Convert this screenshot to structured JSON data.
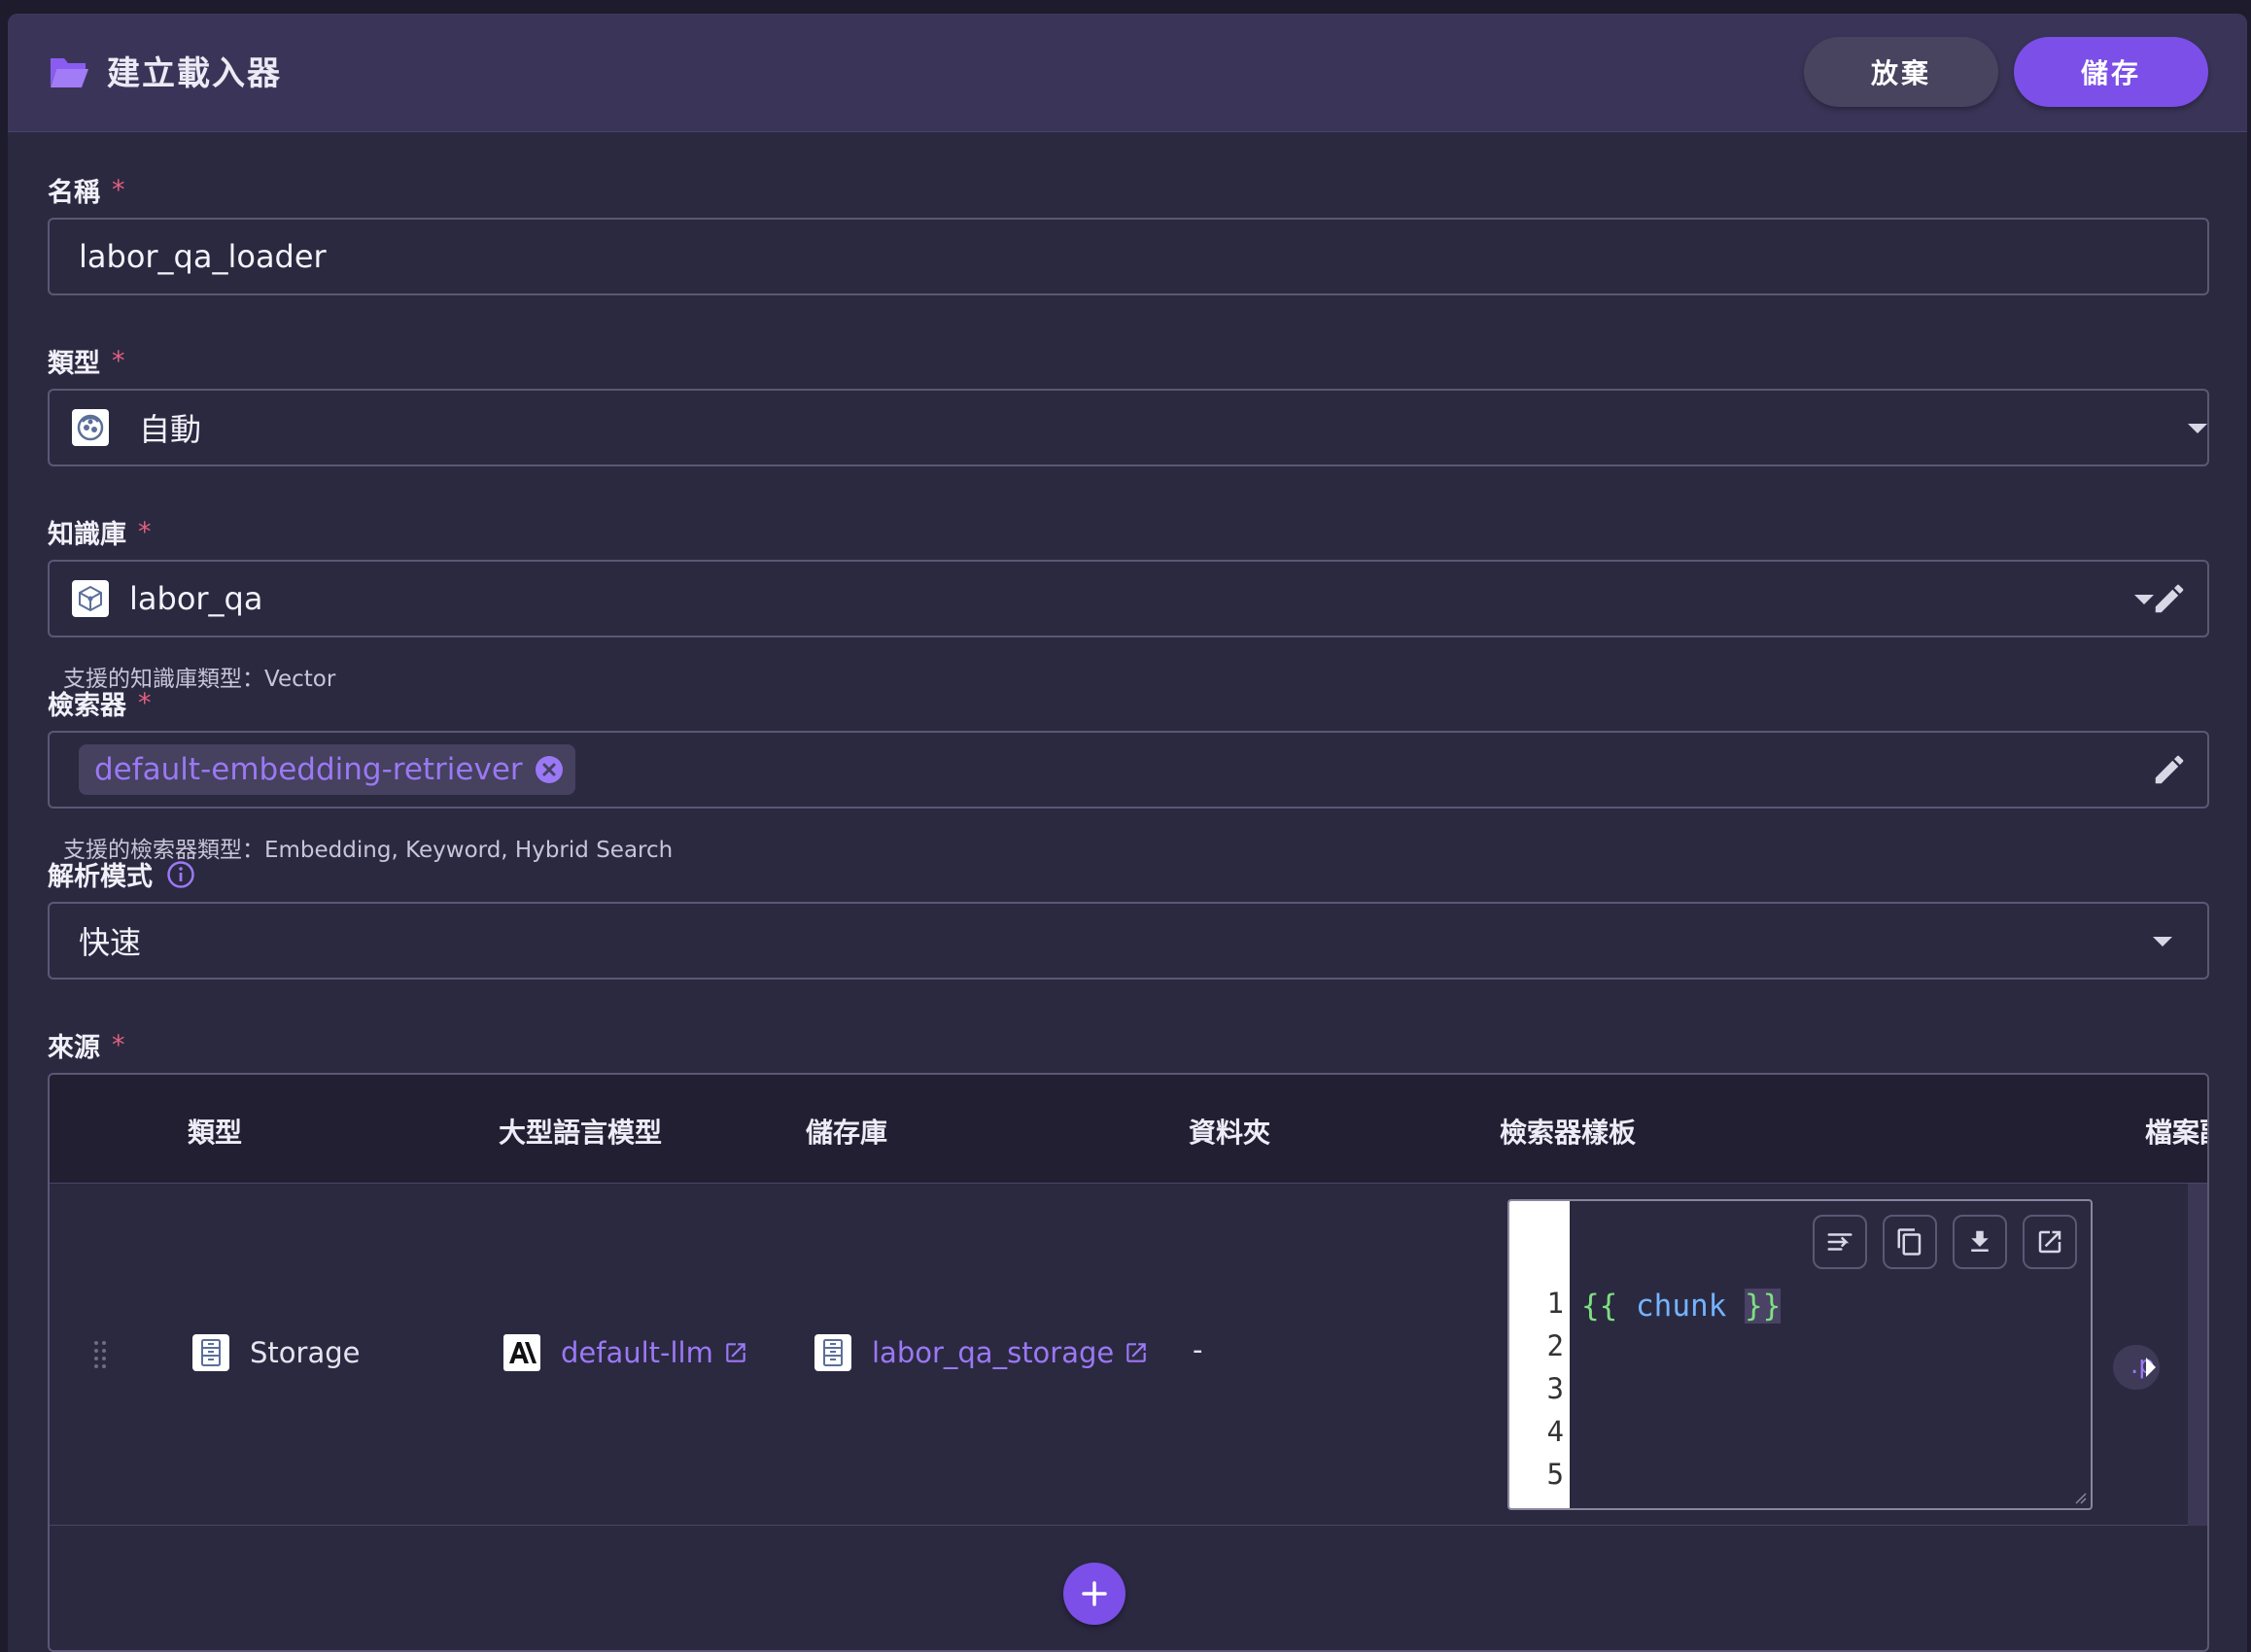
{
  "header": {
    "title": "建立載入器",
    "discard_label": "放棄",
    "save_label": "儲存"
  },
  "fields": {
    "name": {
      "label": "名稱",
      "required": "*",
      "value": "labor_qa_loader"
    },
    "type": {
      "label": "類型",
      "required": "*",
      "value": "自動"
    },
    "knowledge_base": {
      "label": "知識庫",
      "required": "*",
      "value": "labor_qa",
      "hint": "支援的知識庫類型：Vector"
    },
    "retriever": {
      "label": "檢索器",
      "required": "*",
      "chip": "default-embedding-retriever",
      "hint": "支援的檢索器類型：Embedding, Keyword, Hybrid Search"
    },
    "parse_mode": {
      "label": "解析模式",
      "value": "快速"
    },
    "source": {
      "label": "來源",
      "required": "*"
    }
  },
  "table": {
    "columns": [
      "類型",
      "大型語言模型",
      "儲存庫",
      "資料夾",
      "檢索器樣板",
      "檔案副"
    ],
    "rows": [
      {
        "type": "Storage",
        "llm": "default-llm",
        "storage": "labor_qa_storage",
        "folder": "-",
        "template": {
          "line_numbers": [
            "1",
            "2",
            "3",
            "4",
            "5"
          ],
          "open": "{{",
          "keyword": " chunk ",
          "close": "}}"
        },
        "extension_partial": ".p"
      }
    ]
  },
  "colors": {
    "accent": "#7b4fe8",
    "link": "#9b78f5",
    "required": "#e0607e",
    "header_bg": "#3a3558",
    "panel_bg": "#2b2940"
  },
  "icons": {
    "header": "folder-open-icon",
    "type": "auto-type-icon",
    "knowledge_base": "vector-db-icon",
    "llm": "anthropic-logo-icon",
    "storage": "storage-icon"
  }
}
